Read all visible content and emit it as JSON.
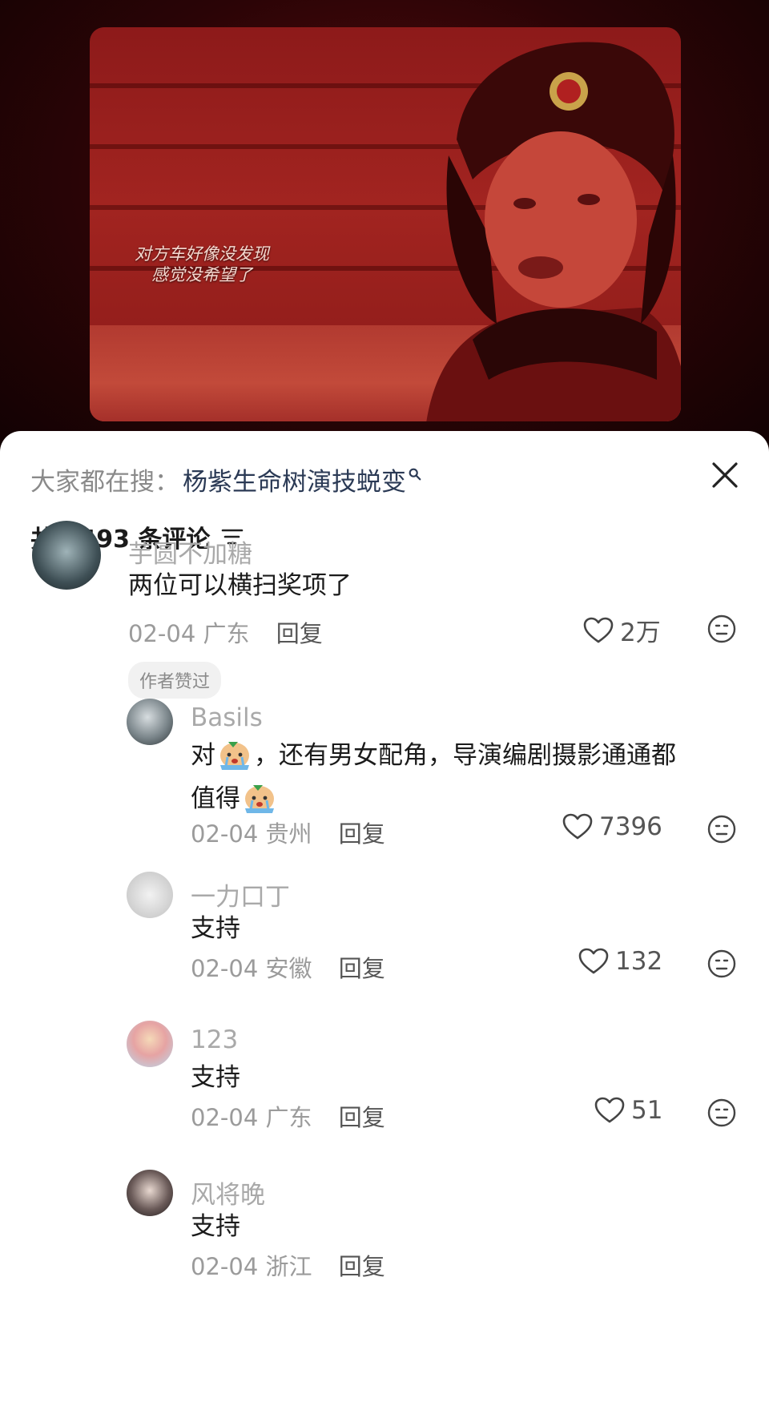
{
  "video": {
    "subtitle_line1": "对方车好像没发现",
    "subtitle_line2": "感觉没希望了"
  },
  "header": {
    "hot_search_label": "大家都在搜：",
    "hot_search_keyword": "杨紫生命树演技蜕变",
    "comment_count_text": "共 1493 条评论"
  },
  "comments": [
    {
      "username": "芋圆不加糖",
      "text": "两位可以横扫奖项了",
      "date": "02-04",
      "location": "广东",
      "reply_label": "回复",
      "likes": "2万",
      "badge": "作者赞过"
    },
    {
      "username": "Basils",
      "text_part1": "对",
      "text_part2": "，还有男女配角，导演编剧摄影通通都",
      "text_part3": "值得",
      "date": "02-04",
      "location": "贵州",
      "reply_label": "回复",
      "likes": "7396"
    },
    {
      "username": "一力口丁",
      "text": "支持",
      "date": "02-04",
      "location": "安徽",
      "reply_label": "回复",
      "likes": "132"
    },
    {
      "username": "123",
      "text": "支持",
      "date": "02-04",
      "location": "广东",
      "reply_label": "回复",
      "likes": "51"
    },
    {
      "username": "风将晚",
      "text": "支持",
      "date": "02-04",
      "location": "浙江",
      "reply_label": "回复"
    }
  ],
  "colors": {
    "keyword": "#2b3a55",
    "muted": "#a9a9a9",
    "text": "#1b1b1b"
  },
  "icons": [
    "search-icon",
    "close-icon",
    "sort-icon",
    "heart-icon",
    "dislike-face-icon",
    "crying-emoji-icon"
  ]
}
